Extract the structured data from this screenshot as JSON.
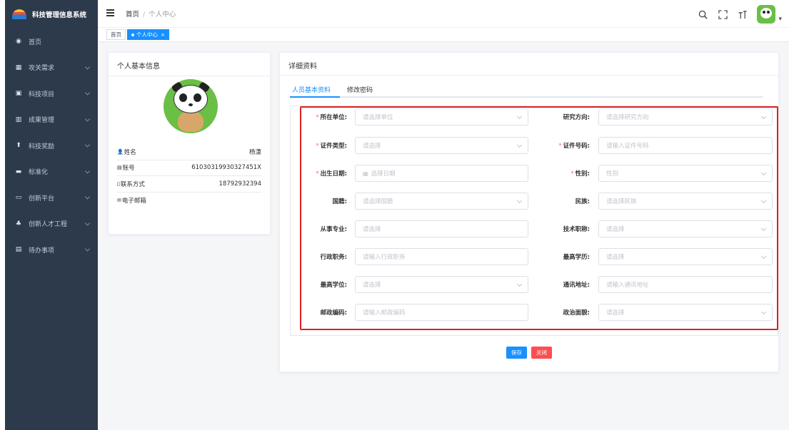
{
  "app": {
    "title": "科技管理信息系统"
  },
  "sidebar": {
    "items": [
      {
        "label": "首页",
        "icon": "dashboard-icon",
        "glyph": "◉",
        "expandable": false
      },
      {
        "label": "攻关需求",
        "icon": "list-icon",
        "glyph": "▦",
        "expandable": true
      },
      {
        "label": "科技项目",
        "icon": "project-icon",
        "glyph": "▣",
        "expandable": true
      },
      {
        "label": "成果管理",
        "icon": "chart-icon",
        "glyph": "▥",
        "expandable": true
      },
      {
        "label": "科技奖励",
        "icon": "award-icon",
        "glyph": "⬆",
        "expandable": true
      },
      {
        "label": "标准化",
        "icon": "standard-icon",
        "glyph": "▬",
        "expandable": true
      },
      {
        "label": "创新平台",
        "icon": "monitor-icon",
        "glyph": "▭",
        "expandable": true
      },
      {
        "label": "创新人才工程",
        "icon": "people-icon",
        "glyph": "♣",
        "expandable": true
      },
      {
        "label": "待办事项",
        "icon": "todo-icon",
        "glyph": "▤",
        "expandable": true
      }
    ]
  },
  "header": {
    "breadcrumb": [
      "首页",
      "个人中心"
    ],
    "breadcrumb_sep": "/",
    "icons": [
      "search-icon",
      "fullscreen-icon",
      "font-size-icon",
      "user-avatar"
    ]
  },
  "tags": {
    "home": "首页",
    "active": "个人中心",
    "close_glyph": "×"
  },
  "profile_card": {
    "title": "个人基本信息",
    "rows": [
      {
        "icon": "user-icon",
        "glyph": "👤",
        "label": "姓名",
        "value": "杨潇"
      },
      {
        "icon": "account-icon",
        "glyph": "▤",
        "label": "账号",
        "value": "61030319930327451X"
      },
      {
        "icon": "phone-icon",
        "glyph": "▯",
        "label": "联系方式",
        "value": "18792932394"
      },
      {
        "icon": "email-icon",
        "glyph": "✉",
        "label": "电子邮箱",
        "value": ""
      }
    ]
  },
  "detail_card": {
    "title": "详细资料",
    "tabs": [
      "人员基本资料",
      "修改密码"
    ],
    "fields": [
      {
        "label": "所在单位:",
        "required": true,
        "placeholder": "请选择单位",
        "type": "select"
      },
      {
        "label": "研究方向:",
        "required": false,
        "placeholder": "请选择研究方向",
        "type": "select"
      },
      {
        "label": "证件类型:",
        "required": true,
        "placeholder": "请选择",
        "type": "select"
      },
      {
        "label": "证件号码:",
        "required": true,
        "placeholder": "请输入证件号码",
        "type": "input"
      },
      {
        "label": "出生日期:",
        "required": true,
        "placeholder": "选择日期",
        "type": "date"
      },
      {
        "label": "性别:",
        "required": true,
        "placeholder": "性别",
        "type": "select"
      },
      {
        "label": "国籍:",
        "required": false,
        "placeholder": "请选择国籍",
        "type": "select"
      },
      {
        "label": "民族:",
        "required": false,
        "placeholder": "请选择民族",
        "type": "select"
      },
      {
        "label": "从事专业:",
        "required": false,
        "placeholder": "请选择",
        "type": "input"
      },
      {
        "label": "技术职称:",
        "required": false,
        "placeholder": "请选择",
        "type": "select"
      },
      {
        "label": "行政职务:",
        "required": false,
        "placeholder": "请输入行政职务",
        "type": "input"
      },
      {
        "label": "最高学历:",
        "required": false,
        "placeholder": "请选择",
        "type": "select"
      },
      {
        "label": "最高学位:",
        "required": false,
        "placeholder": "请选择",
        "type": "select"
      },
      {
        "label": "通讯地址:",
        "required": false,
        "placeholder": "请输入通讯地址",
        "type": "input"
      },
      {
        "label": "邮政编码:",
        "required": false,
        "placeholder": "请输入邮政编码",
        "type": "input"
      },
      {
        "label": "政治面貌:",
        "required": false,
        "placeholder": "请选择",
        "type": "select"
      }
    ],
    "buttons": {
      "save": "保存",
      "close": "关闭"
    }
  },
  "colors": {
    "sidebar_bg": "#2d3a4b",
    "primary": "#1890ff",
    "danger": "#ff4d4f",
    "highlight_box": "#e02020"
  }
}
